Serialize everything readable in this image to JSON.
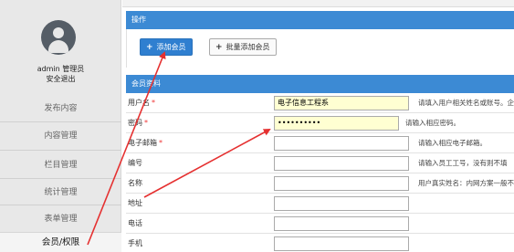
{
  "sidebar": {
    "user_name": "admin 管理员",
    "logout": "安全退出",
    "items": [
      {
        "label": "发布内容"
      },
      {
        "label": "内容管理"
      },
      {
        "label": "栏目管理"
      },
      {
        "label": "统计管理"
      },
      {
        "label": "表单管理"
      },
      {
        "label": "会员/权限"
      }
    ]
  },
  "ops": {
    "title": "操作",
    "add_member": "添加会员",
    "batch_add": "批量添加会员"
  },
  "info": {
    "title": "会员资料"
  },
  "form": {
    "rows": [
      {
        "label": "用户名",
        "value": "电子信息工程系",
        "hint": "请填入用户相关姓名或账号。企业"
      },
      {
        "label": "密码",
        "value": "••••••••••",
        "hint": "请输入相应密码。"
      },
      {
        "label": "电子邮箱",
        "value": "",
        "hint": "请输入相应电子邮箱。"
      },
      {
        "label": "编号",
        "value": "",
        "hint": "请输入员工工号，没有则不填"
      },
      {
        "label": "名称",
        "value": "",
        "hint": "用户真实姓名：内网方案一般不填"
      },
      {
        "label": "地址",
        "value": "",
        "hint": ""
      },
      {
        "label": "电话",
        "value": "",
        "hint": ""
      },
      {
        "label": "手机",
        "value": "",
        "hint": ""
      }
    ],
    "required_mark": "*"
  },
  "icons": {
    "avatar": "user-avatar-icon",
    "plus": "plus-icon"
  },
  "colors": {
    "accent": "#3c8ad4",
    "primary_button": "#2f7fd0",
    "annotation_arrow": "#e53030",
    "highlight_field": "#ffffd2"
  }
}
